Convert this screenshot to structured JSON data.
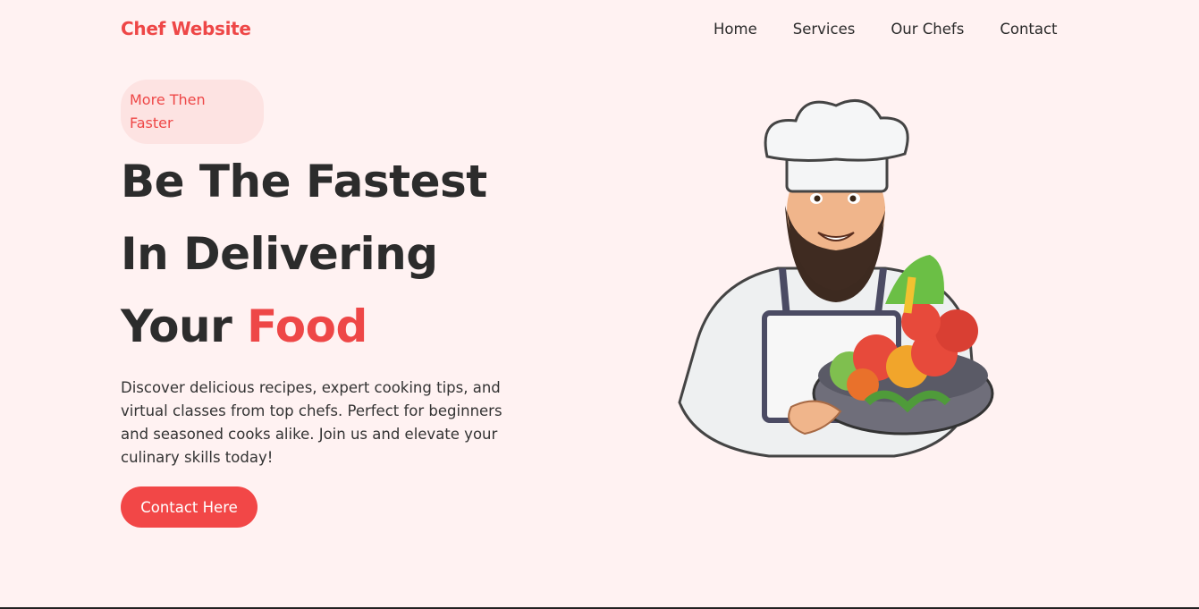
{
  "nav": {
    "brand": "Chef Website",
    "items": [
      {
        "label": "Home"
      },
      {
        "label": "Services"
      },
      {
        "label": "Our Chefs"
      },
      {
        "label": "Contact"
      }
    ]
  },
  "hero": {
    "badge_line1": "More Then",
    "badge_line2": "Faster",
    "headline_line1": "Be The Fastest",
    "headline_line2": "In Delivering",
    "headline_line3_prefix": "Your ",
    "headline_line3_accent": "Food",
    "description": "Discover delicious recipes, expert cooking tips, and virtual classes from top chefs. Perfect for beginners and seasoned cooks alike. Join us and elevate your culinary skills today!",
    "cta_label": "Contact Here"
  },
  "colors": {
    "accent": "#ee4747",
    "background": "#fff2f2",
    "badge_bg": "#fde3e2",
    "text": "#2c2c2c"
  },
  "images": {
    "hero": "chef-holding-vegetable-bowl"
  }
}
